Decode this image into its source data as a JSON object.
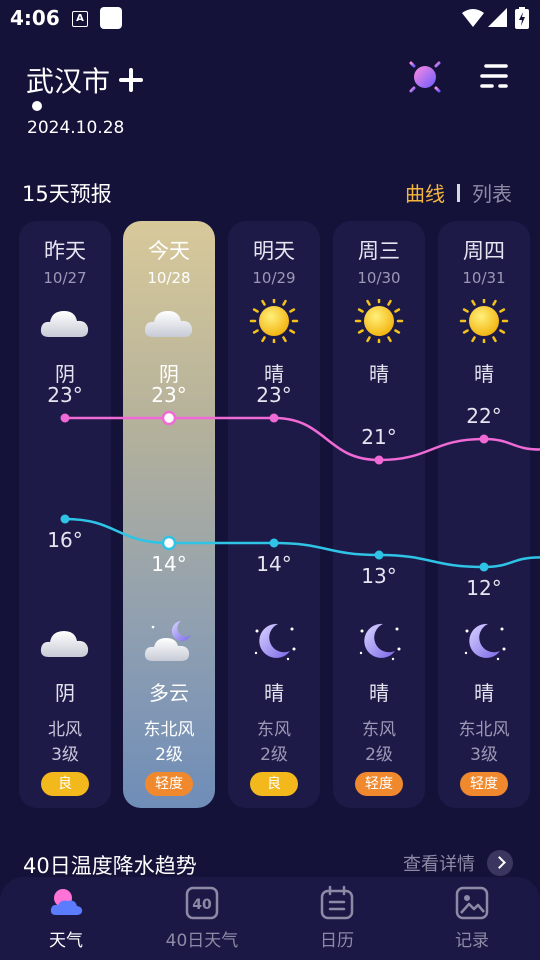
{
  "status_bar": {
    "time": "4:06",
    "notification_letter": "A"
  },
  "header": {
    "city": "武汉市",
    "date": "2024.10.28"
  },
  "forecast": {
    "title": "15天预报",
    "toggle_curve": "曲线",
    "toggle_list": "列表",
    "days": [
      {
        "label": "昨天",
        "date": "10/27",
        "day_weather": "阴",
        "day_icon": "cloud-icon",
        "high": "23°",
        "low": "16°",
        "night_weather": "阴",
        "night_icon": "cloud-icon",
        "wind_dir": "北风",
        "wind_level": "3级",
        "aqi": "良",
        "aqi_color": "#f2b81c"
      },
      {
        "label": "今天",
        "date": "10/28",
        "day_weather": "阴",
        "day_icon": "cloud-icon",
        "high": "23°",
        "low": "14°",
        "night_weather": "多云",
        "night_icon": "cloudy-night-icon",
        "wind_dir": "东北风",
        "wind_level": "2级",
        "aqi": "轻度",
        "aqi_color": "#f0892e"
      },
      {
        "label": "明天",
        "date": "10/29",
        "day_weather": "晴",
        "day_icon": "sun-icon",
        "high": "23°",
        "low": "14°",
        "night_weather": "晴",
        "night_icon": "moon-icon",
        "wind_dir": "东风",
        "wind_level": "2级",
        "aqi": "良",
        "aqi_color": "#f2b81c"
      },
      {
        "label": "周三",
        "date": "10/30",
        "day_weather": "晴",
        "day_icon": "sun-icon",
        "high": "21°",
        "low": "13°",
        "night_weather": "晴",
        "night_icon": "moon-icon",
        "wind_dir": "东风",
        "wind_level": "2级",
        "aqi": "轻度",
        "aqi_color": "#f0892e"
      },
      {
        "label": "周四",
        "date": "10/31",
        "day_weather": "晴",
        "day_icon": "sun-icon",
        "high": "22°",
        "low": "12°",
        "night_weather": "晴",
        "night_icon": "moon-icon",
        "wind_dir": "东北风",
        "wind_level": "3级",
        "aqi": "轻度",
        "aqi_color": "#f0892e"
      }
    ],
    "high_temps": [
      23,
      23,
      23,
      21,
      22
    ],
    "low_temps": [
      16,
      14,
      14,
      13,
      12
    ],
    "high_color": "#f06ad6",
    "low_color": "#2fc3e6"
  },
  "trend": {
    "title": "40日温度降水趋势",
    "more_label": "查看详情"
  },
  "nav": {
    "items": [
      {
        "label": "天气",
        "icon": "weather-icon",
        "active": true
      },
      {
        "label": "40日天气",
        "icon": "calendar-40-icon",
        "active": false
      },
      {
        "label": "日历",
        "icon": "calendar-icon",
        "active": false
      },
      {
        "label": "记录",
        "icon": "photo-icon",
        "active": false
      }
    ]
  },
  "colors": {
    "background": "#15123a",
    "accent": "#f4b63e"
  }
}
